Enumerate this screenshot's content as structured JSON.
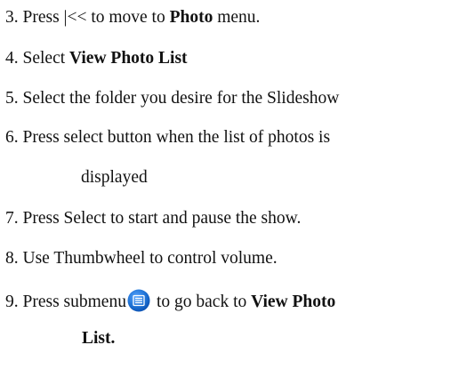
{
  "steps": [
    {
      "num": "3.",
      "pre": "Press |<< to move to ",
      "bold": "Photo",
      "post": " menu."
    },
    {
      "num": "4.",
      "pre": "Select ",
      "bold": "View Photo List",
      "post": ""
    },
    {
      "num": "5.",
      "text": "Select the folder you desire for the Slideshow"
    },
    {
      "num": "6.",
      "text": "Press select button when the list of photos is",
      "cont": "displayed"
    },
    {
      "num": "7.",
      "text": "Press Select to start and pause the show."
    },
    {
      "num": "8.",
      "text": "Use Thumbwheel to control volume."
    },
    {
      "num": "9.",
      "pre": "Press submenu",
      "icon": "submenu-icon",
      "mid": "to go back to ",
      "bold": "View Photo",
      "bold_cont": "List."
    }
  ],
  "colors": {
    "icon_blue": "#1f73d6",
    "icon_blue_dark": "#0a4fb0"
  }
}
